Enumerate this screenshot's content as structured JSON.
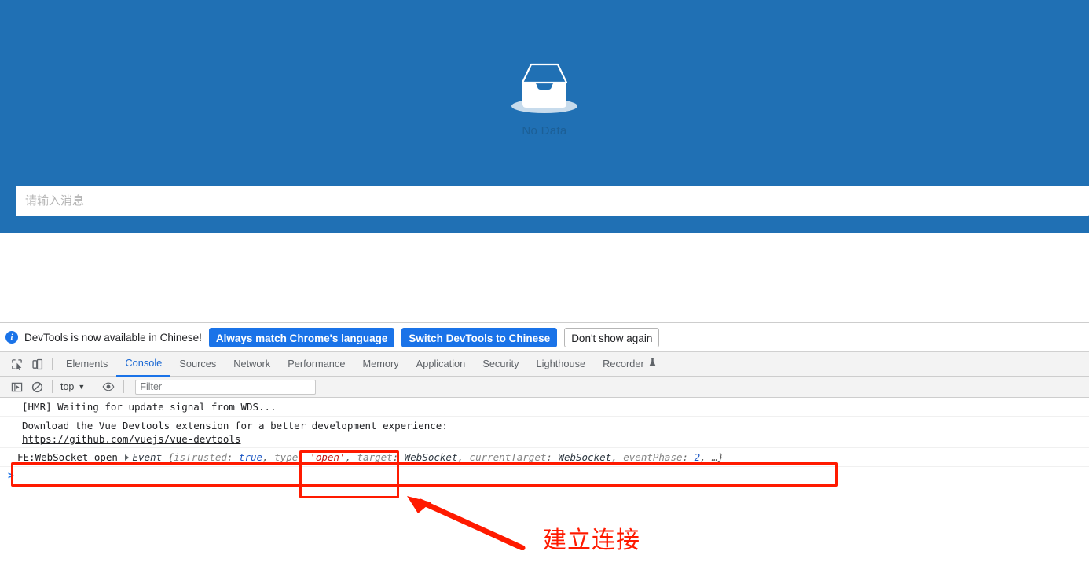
{
  "app": {
    "empty_state": {
      "icon": "inbox-tray-icon",
      "label": "No Data"
    },
    "message_input": {
      "placeholder": "请输入消息",
      "value": ""
    },
    "background_color": "#2070b4"
  },
  "devtools": {
    "banner": {
      "icon": "info-icon",
      "text": "DevTools is now available in Chinese!",
      "buttons": [
        {
          "label": "Always match Chrome's language",
          "style": "primary"
        },
        {
          "label": "Switch DevTools to Chinese",
          "style": "primary"
        },
        {
          "label": "Don't show again",
          "style": "secondary"
        }
      ],
      "accent_color": "#1a73e8"
    },
    "tabbar": {
      "inspect_icon": "inspect-element-icon",
      "device_icon": "device-toolbar-icon",
      "tabs": [
        {
          "label": "Elements",
          "active": false,
          "experimental": false
        },
        {
          "label": "Console",
          "active": true,
          "experimental": false
        },
        {
          "label": "Sources",
          "active": false,
          "experimental": false
        },
        {
          "label": "Network",
          "active": false,
          "experimental": false
        },
        {
          "label": "Performance",
          "active": false,
          "experimental": false
        },
        {
          "label": "Memory",
          "active": false,
          "experimental": false
        },
        {
          "label": "Application",
          "active": false,
          "experimental": false
        },
        {
          "label": "Security",
          "active": false,
          "experimental": false
        },
        {
          "label": "Lighthouse",
          "active": false,
          "experimental": false
        },
        {
          "label": "Recorder",
          "active": false,
          "experimental": true
        }
      ],
      "active_color": "#1a73e8"
    },
    "console_toolbar": {
      "sidebar_icon": "console-sidebar-icon",
      "clear_icon": "clear-console-icon",
      "context": "top",
      "eye_icon": "live-expression-eye-icon",
      "filter_placeholder": "Filter",
      "filter_value": ""
    },
    "console_log": {
      "messages": [
        {
          "type": "plain",
          "text": "[HMR] Waiting for update signal from WDS..."
        },
        {
          "type": "link",
          "text": "Download the Vue Devtools extension for a better development experience:",
          "link": "https://github.com/vuejs/vue-devtools"
        },
        {
          "type": "object",
          "prefix": "FE:WebSocket open",
          "object_name": "Event",
          "props": [
            {
              "key": "isTrusted",
              "value": "true",
              "kind": "bool"
            },
            {
              "key": "type",
              "value": "'open'",
              "kind": "str"
            },
            {
              "key": "target",
              "value": "WebSocket",
              "kind": "obj"
            },
            {
              "key": "currentTarget",
              "value": "WebSocket",
              "kind": "obj"
            },
            {
              "key": "eventPhase",
              "value": "2",
              "kind": "num"
            }
          ],
          "ellipsis": "…"
        }
      ],
      "prompt": ">"
    }
  },
  "annotations": {
    "label": "建立连接",
    "color": "#ff1a00",
    "arrow": "red-arrow-up-left",
    "boxes": [
      "log-line-highlight",
      "type-open-highlight"
    ]
  }
}
